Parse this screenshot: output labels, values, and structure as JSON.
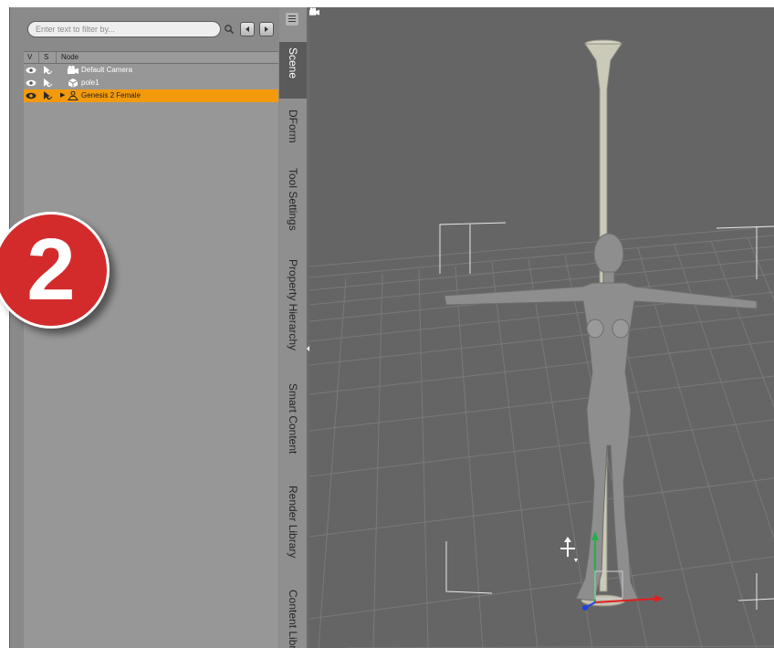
{
  "scene_pane": {
    "filter_placeholder": "Enter text to filter by...",
    "search_icon": "search-icon",
    "prev_icon": "arrow-left-icon",
    "next_icon": "arrow-right-icon",
    "columns": {
      "visible": "V",
      "selectable": "S",
      "node": "Node"
    },
    "nodes": [
      {
        "label": "Default Camera",
        "icon": "camera-icon",
        "selected": false,
        "expandable": false
      },
      {
        "label": "pole1",
        "icon": "prop-icon",
        "selected": false,
        "expandable": false
      },
      {
        "label": "Genesis 2 Female",
        "icon": "figure-icon",
        "selected": true,
        "expandable": true
      }
    ],
    "selection_color": "#f29a0c"
  },
  "tabs": [
    {
      "label": "Scene",
      "active": true
    },
    {
      "label": "DForm",
      "active": false
    },
    {
      "label": "Tool Settings",
      "active": false
    },
    {
      "label": "Property Hierarchy",
      "active": false
    },
    {
      "label": "Smart Content",
      "active": false
    },
    {
      "label": "Render Library",
      "active": false
    },
    {
      "label": "Content Library",
      "active": false
    }
  ],
  "viewport": {
    "camera_icon": "camera-icon",
    "manipulator_icon": "transform-gizmo-icon",
    "background": "#656565"
  },
  "overlay": {
    "step_number": "2",
    "badge_color": "#d32b2b"
  }
}
